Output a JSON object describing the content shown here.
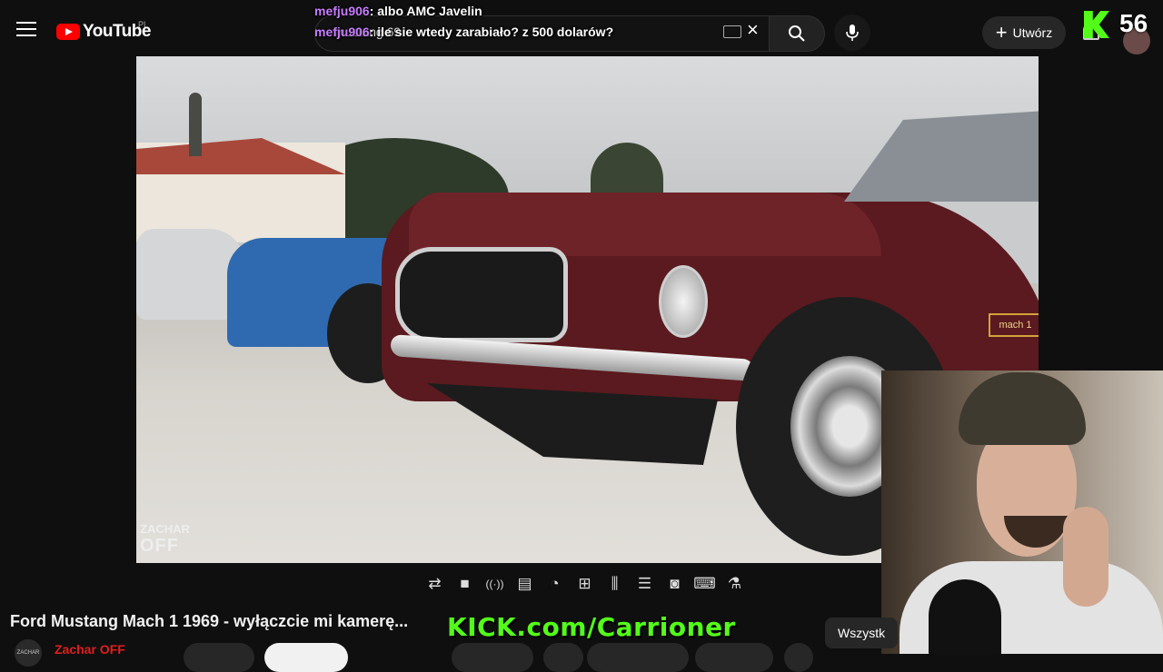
{
  "header": {
    "logo_text": "YouTube",
    "country_code": "PL",
    "search_value": "mustang 69",
    "create_label": "Utwórz"
  },
  "overlay": {
    "chat": [
      {
        "user": "mefju906",
        "message": ": albo AMC Javelin"
      },
      {
        "user": "mefju906",
        "message": ": ile sie wtedy zarabiało? z 500 dolarów?"
      }
    ],
    "viewer_count": "56",
    "kick_url": "KICK.com/Carrioner",
    "accent_color": "#53fc18"
  },
  "video": {
    "watermark_line1": "ZACHAR",
    "watermark_line2": "OFF",
    "badge_text": "mach 1"
  },
  "controls": [
    {
      "name": "loop-icon",
      "glyph": "⇄"
    },
    {
      "name": "stop-icon",
      "glyph": "■"
    },
    {
      "name": "broadcast-icon",
      "glyph": "((·))"
    },
    {
      "name": "caption-frame-icon",
      "glyph": "▤"
    },
    {
      "name": "speed-icon",
      "glyph": "◔"
    },
    {
      "name": "add-box-icon",
      "glyph": "⊞"
    },
    {
      "name": "split-icon",
      "glyph": "⫼"
    },
    {
      "name": "layout-icon",
      "glyph": "☰"
    },
    {
      "name": "camera-icon",
      "glyph": "◙"
    },
    {
      "name": "keyboard-icon",
      "glyph": "⌨"
    },
    {
      "name": "flask-icon",
      "glyph": "⚗"
    }
  ],
  "below": {
    "title": "Ford Mustang Mach 1 1969 - wyłączcie mi kamerę...",
    "channel_avatar_text": "ZACHAR",
    "channel_name": "Zachar OFF",
    "filter_all": "Wszystk"
  }
}
